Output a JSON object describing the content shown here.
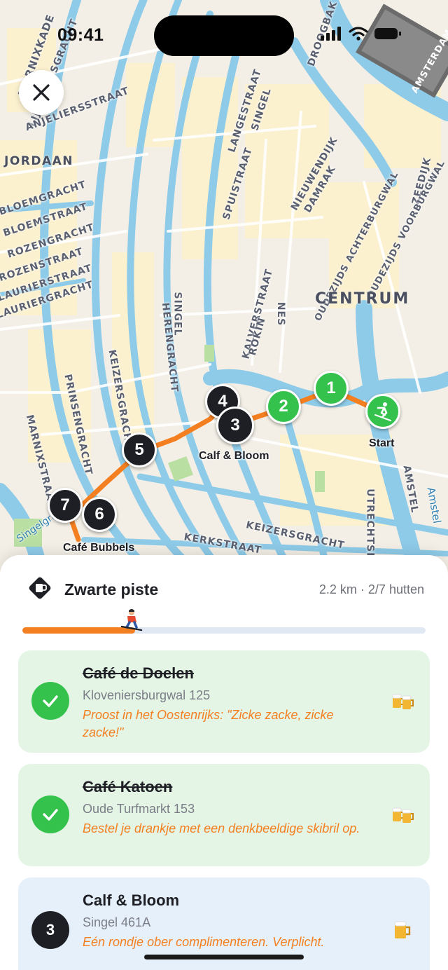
{
  "status_bar": {
    "time": "09:41"
  },
  "map": {
    "district_labels": {
      "jordaan": "JORDAAN",
      "centrum": "CENTRUM"
    },
    "street_labels": {
      "marnixkade": "MARNIXKADE",
      "lijnbaansgracht": "LIJNBAANSGRACHT",
      "anjeliersstraat": "ANJELIERSSTRAAT",
      "bloemgracht": "BLOEMGRACHT",
      "bloemstraat": "BLOEMSTRAAT",
      "rozengracht": "ROZENGRACHT",
      "rozenstraat": "ROZENSTRAAT",
      "laurierstraat": "LAURIERSTRAAT",
      "lauriergracht": "LAURIERGRACHT",
      "langestraat": "LANGESTRAAT",
      "singel_top": "SINGEL",
      "spuistraat": "SPUISTRAAT",
      "nieuwendijk": "NIEUWENDIJK",
      "damrak": "DAMRAK",
      "zeedijk": "ZEEDIJK",
      "oudezijds_voorburgwal": "OUDEZIJDS VOORBURGWAL",
      "oudezijds_achterburgwal": "OUDEZIJDS ACHTERBURGWAL",
      "kalverstraat": "KALVERSTRAAT",
      "rokin": "ROKIN",
      "nes": "NES",
      "singel": "SINGEL",
      "herengracht": "HERENGRACHT",
      "keizersgracht": "KEIZERSGRACHT",
      "prinsengracht": "PRINSENGRACHT",
      "marnixstraat": "MARNIXSTRAAT",
      "singelgracht": "Singelgracht",
      "kerkstraat": "KERKSTRAAT",
      "keizersgracht_bottom": "KEIZERSGRACHT",
      "utrechtsestraat": "UTRECHTSE",
      "amstel": "AMSTEL",
      "amstel_river": "Amstel",
      "droogbak": "DROOGBAK",
      "amsterdam_station": "AMSTERDAM"
    },
    "markers": [
      {
        "label": "1",
        "state": "done"
      },
      {
        "label": "2",
        "state": "done"
      },
      {
        "label": "3",
        "state": "current"
      },
      {
        "label": "4",
        "state": "todo"
      },
      {
        "label": "5",
        "state": "todo"
      },
      {
        "label": "6",
        "state": "todo"
      },
      {
        "label": "7",
        "state": "todo"
      }
    ],
    "marker_labels": {
      "start": "Start",
      "calf_bloom": "Calf & Bloom",
      "cafe_bubbels": "Café Bubbels"
    },
    "route_color": "#f47f20"
  },
  "sheet": {
    "title": "Zwarte piste",
    "meta": "2.2 km · 2/7 hutten",
    "progress_fraction": 0.28,
    "stops": [
      {
        "name": "Café de Doelen",
        "address": "Kloveniersburgwal 125",
        "task": "Proost in het Oostenrijks: \"Zicke zacke, zicke zacke!\"",
        "state": "done",
        "emoji": "beer-mugs-icon"
      },
      {
        "name": "Café Katoen",
        "address": "Oude Turfmarkt 153",
        "task": "Bestel je drankje met een denkbeeldige skibril op.",
        "state": "done",
        "emoji": "beer-mugs-icon"
      },
      {
        "name": "Calf & Bloom",
        "number": "3",
        "address": "Singel 461A",
        "task": "Eén rondje ober complimenteren. Verplicht.",
        "state": "current",
        "emoji": "beer-mug-icon"
      }
    ]
  },
  "colors": {
    "accent": "#f47f20",
    "done": "#34c24c",
    "dark": "#1e1f24",
    "water": "#8ecbe8"
  }
}
